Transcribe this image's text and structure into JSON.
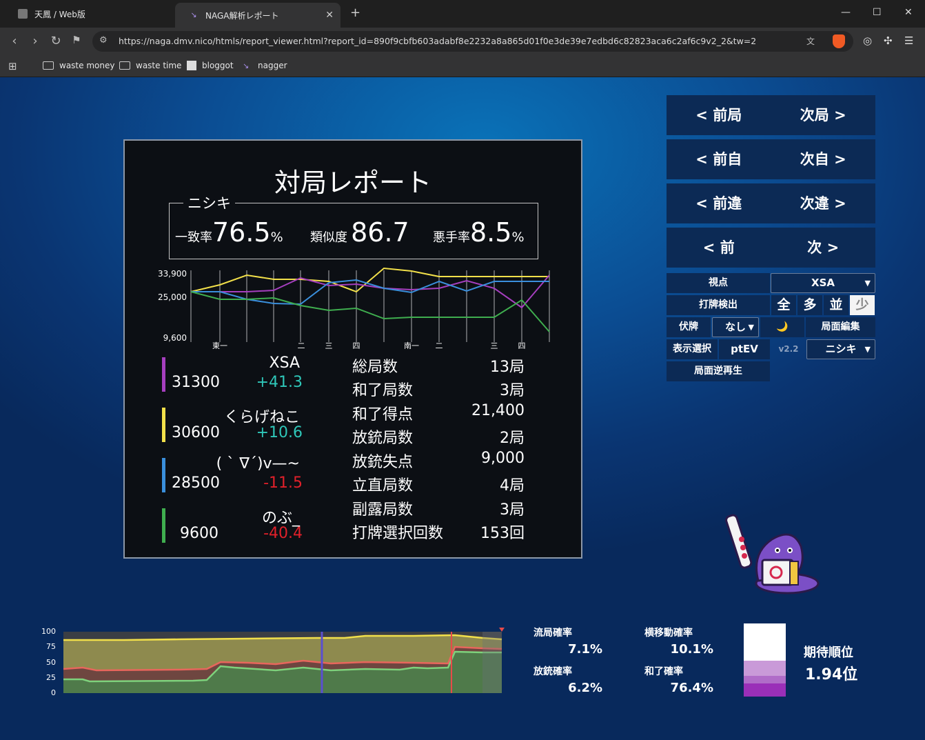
{
  "browser": {
    "tabs": [
      {
        "title": "天鳳 / Web版"
      },
      {
        "title": "NAGA解析レポート"
      }
    ],
    "url": "https://naga.dmv.nico/htmls/report_viewer.html?report_id=890f9cbfb603adabf8e2232a8a865d01f0e3de39e7edbd6c82823aca6c2af6c9v2_2&tw=2",
    "bookmarks": [
      "waste money",
      "waste time",
      "bloggot",
      "nagger"
    ]
  },
  "report": {
    "title": "対局レポート",
    "player": "ニシキ",
    "stats": [
      {
        "label": "一致率",
        "value": "76.5",
        "unit": "%"
      },
      {
        "label": "類似度",
        "value": "86.7",
        "unit": ""
      },
      {
        "label": "悪手率",
        "value": "8.5",
        "unit": "%"
      }
    ],
    "mini_chart": {
      "y_ticks": [
        "33,900",
        "25,000",
        "9,600"
      ],
      "x_labels": [
        "東一",
        "二",
        "三",
        "四",
        "南一",
        "二",
        "三",
        "四"
      ],
      "colors": {
        "XSA": "#a63fbf",
        "くらげねこ": "#f2e04a",
        "( ` ∇´)v—~": "#3a8fdc",
        "のぶ_": "#3fae4f"
      }
    },
    "players": [
      {
        "name": "XSA",
        "score": "31300",
        "delta": "+41.3",
        "color": "#a63fbf",
        "delta_color": "#2fc7b9"
      },
      {
        "name": "くらげねこ",
        "score": "30600",
        "delta": "+10.6",
        "color": "#f2e04a",
        "delta_color": "#2fc7b9"
      },
      {
        "name": "( ` ∇´)v—~",
        "score": "28500",
        "delta": "-11.5",
        "color": "#3a8fdc",
        "delta_color": "#e0202a"
      },
      {
        "name": "のぶ_",
        "score": "9600",
        "delta": "-40.4",
        "color": "#3fae4f",
        "delta_color": "#e0202a"
      }
    ],
    "summary": [
      {
        "k": "総局数",
        "v": "13局"
      },
      {
        "k": "和了局数",
        "v": "3局"
      },
      {
        "k": "和了得点",
        "v": "21,400"
      },
      {
        "k": "放銃局数",
        "v": "2局"
      },
      {
        "k": "放銃失点",
        "v": "9,000"
      },
      {
        "k": "立直局数",
        "v": "4局"
      },
      {
        "k": "副露局数",
        "v": "3局"
      },
      {
        "k": "打牌選択回数",
        "v": "153回"
      }
    ]
  },
  "controls": {
    "nav": [
      {
        "prev": "< 前局",
        "next": "次局 >"
      },
      {
        "prev": "< 前自",
        "next": "次自 >"
      },
      {
        "prev": "< 前違",
        "next": "次違 >"
      },
      {
        "prev": "< 前",
        "next": "次 >"
      }
    ],
    "viewpoint_label": "視点",
    "viewpoint_value": "XSA",
    "detect_label": "打牌検出",
    "density": [
      "全",
      "多",
      "並",
      "少"
    ],
    "density_selected": "少",
    "hidden_label": "伏牌",
    "hidden_value": "なし",
    "moon_icon": "🌙",
    "edit_label": "局面編集",
    "display_label": "表示選択",
    "ptev_label": "ptEV",
    "version": "v2.2",
    "model_value": "ニシキ",
    "replay_label": "局面逆再生"
  },
  "probabilities": {
    "y_ticks": [
      "100",
      "75",
      "50",
      "25",
      "0"
    ],
    "ryuukyoku_label": "流局確率",
    "ryuukyoku": "7.1%",
    "yoko_label": "横移動確率",
    "yoko": "10.1%",
    "houjuu_label": "放銃確率",
    "houjuu": "6.2%",
    "agari_label": "和了確率",
    "agari": "76.4%",
    "rank_label": "期待順位",
    "rank": "1.94位"
  }
}
